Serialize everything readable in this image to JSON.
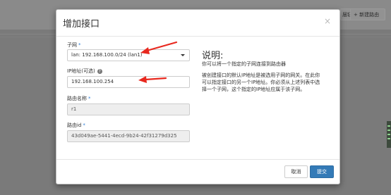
{
  "background": {
    "btn_partial_label": "届钮",
    "btn_new_route_label": "+ 新建路由"
  },
  "modal": {
    "title": "增加接口",
    "close_glyph": "×",
    "subnet": {
      "label": "子网",
      "required_mark": "*",
      "value": "lan: 192.168.100.0/24 (lan1)"
    },
    "ip": {
      "label": "IP地址(可选)",
      "help_glyph": "?",
      "value": "192.168.100.254"
    },
    "router_name": {
      "label": "路由名称",
      "required_mark": "*",
      "value": "r1"
    },
    "router_id": {
      "label": "路由id",
      "required_mark": "*",
      "value": "43d049ae-5441-4ecd-9b24-42f31279d325"
    },
    "description": {
      "title": "说明:",
      "lines": [
        "你可以将一个指定的子网连接到路由器",
        "被创建接口的默认IP地址是被选用子网的网关。在此你",
        "可以指定接口的另一个IP地址。你必须从上述列表中选",
        "择一个子网，这个指定的IP地址应属于该子网。"
      ]
    },
    "footer": {
      "cancel_label": "取消",
      "submit_label": "提交"
    }
  },
  "colors": {
    "arrow": "#e8281e",
    "primary": "#337ab7",
    "required": "#2f7ed8"
  }
}
